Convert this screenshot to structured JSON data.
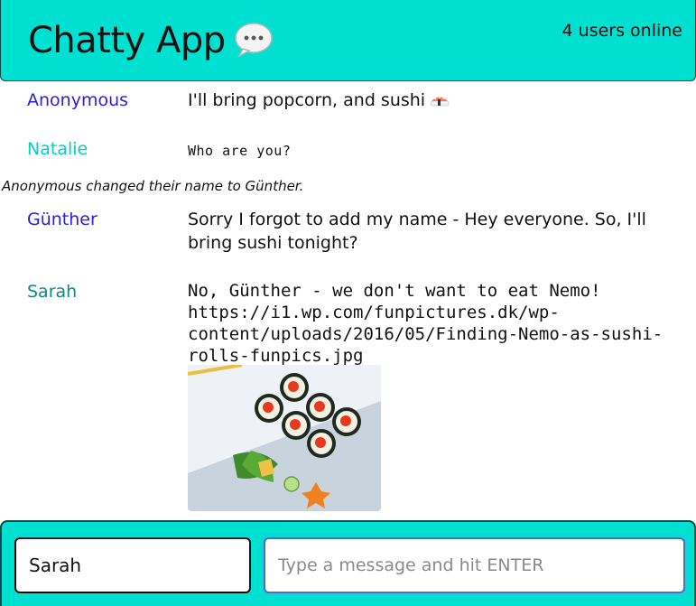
{
  "navbar": {
    "brand": "Chatty App",
    "brand_icon": "speech-bubble-icon",
    "users_online": "4 users online"
  },
  "messages": [
    {
      "type": "message",
      "username": "Anonymous",
      "content": "I'll bring popcorn, and sushi",
      "emoji": "sushi-icon",
      "color": "#2a1fe0"
    },
    {
      "type": "message",
      "username": "Natalie",
      "content": "Who are you?",
      "color": "#00d0c8"
    },
    {
      "type": "notification",
      "content": "Anonymous changed their name to Günther."
    },
    {
      "type": "message",
      "username": "Günther",
      "content": "Sorry I forgot to add my name - Hey everyone. So, I'll bring sushi tonight?",
      "color": "#2a1fe0"
    },
    {
      "type": "message",
      "username": "Sarah",
      "content": "No, Günther - we don't want to eat Nemo! https://i1.wp.com/funpictures.dk/wp-content/uploads/2016/05/Finding-Nemo-as-sushi-rolls-funpics.jpg",
      "color": "#0a8a80",
      "image": "sushi-rolls-photo"
    }
  ],
  "chatbar": {
    "username_value": "Sarah",
    "message_placeholder": "Type a message and hit ENTER"
  },
  "colors": {
    "bar_background": "#00e0d0",
    "user_blue": "#2a1fe0",
    "user_teal": "#00d0c8",
    "user_darkteal": "#0a8a80"
  }
}
